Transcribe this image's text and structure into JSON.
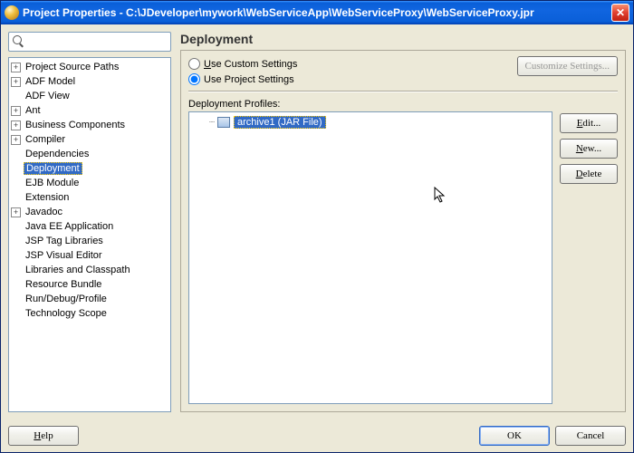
{
  "titlebar": {
    "title": "Project Properties - C:\\JDeveloper\\mywork\\WebServiceApp\\WebServiceProxy\\WebServiceProxy.jpr"
  },
  "search": {
    "value": ""
  },
  "tree": {
    "items": [
      {
        "label": "Project Source Paths",
        "expandable": true
      },
      {
        "label": "ADF Model",
        "expandable": true
      },
      {
        "label": "ADF View",
        "expandable": false
      },
      {
        "label": "Ant",
        "expandable": true
      },
      {
        "label": "Business Components",
        "expandable": true
      },
      {
        "label": "Compiler",
        "expandable": true
      },
      {
        "label": "Dependencies",
        "expandable": false
      },
      {
        "label": "Deployment",
        "expandable": false,
        "selected": true
      },
      {
        "label": "EJB Module",
        "expandable": false
      },
      {
        "label": "Extension",
        "expandable": false
      },
      {
        "label": "Javadoc",
        "expandable": true
      },
      {
        "label": "Java EE Application",
        "expandable": false
      },
      {
        "label": "JSP Tag Libraries",
        "expandable": false
      },
      {
        "label": "JSP Visual Editor",
        "expandable": false
      },
      {
        "label": "Libraries and Classpath",
        "expandable": false
      },
      {
        "label": "Resource Bundle",
        "expandable": false
      },
      {
        "label": "Run/Debug/Profile",
        "expandable": false
      },
      {
        "label": "Technology Scope",
        "expandable": false
      }
    ]
  },
  "panel": {
    "title": "Deployment",
    "use_custom": "Use Custom Settings",
    "use_project": "Use Project Settings",
    "customize_label": "Customize Settings...",
    "profiles_label": "Deployment Profiles:",
    "profile_item": "archive1 (JAR File)",
    "edit_label": "Edit...",
    "new_label": "New...",
    "delete_label": "Delete"
  },
  "footer": {
    "help": "Help",
    "ok": "OK",
    "cancel": "Cancel"
  }
}
